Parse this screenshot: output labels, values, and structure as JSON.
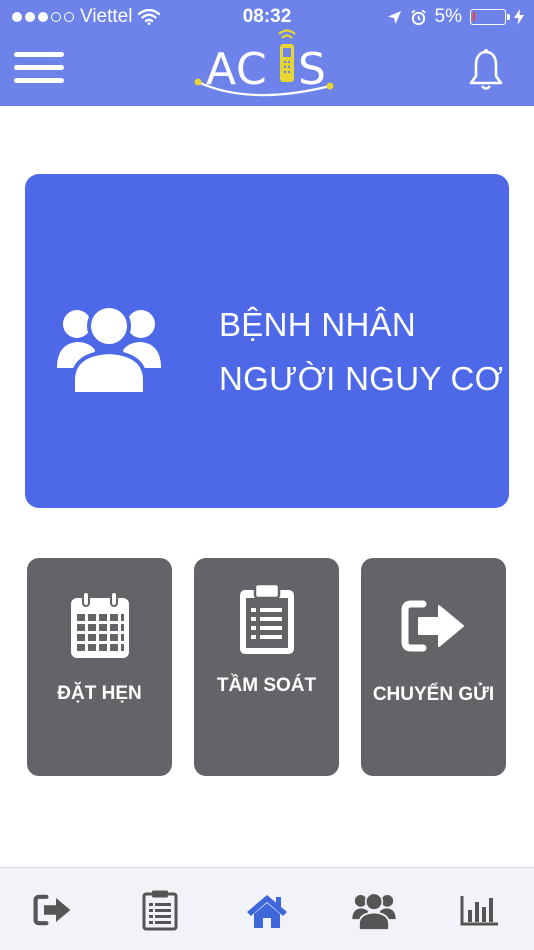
{
  "status_bar": {
    "carrier": "Viettel",
    "time": "08:32",
    "battery": "5%",
    "battery_level": 0.05
  },
  "header": {
    "logo_text": "ACIS",
    "menu_icon": "hamburger-menu-icon",
    "notification_icon": "bell-icon"
  },
  "hero": {
    "line1": "BỆNH NHÂN",
    "line2": "NGƯỜI NGUY CƠ",
    "icon": "people-group-icon"
  },
  "tiles": [
    {
      "label": "ĐẶT HẸN",
      "icon": "calendar-icon"
    },
    {
      "label": "TẦM SOÁT",
      "icon": "clipboard-icon"
    },
    {
      "label": "CHUYỂN GỬI",
      "icon": "sign-out-icon"
    }
  ],
  "tabbar": {
    "items": [
      {
        "icon": "sign-out-icon",
        "active": false
      },
      {
        "icon": "clipboard-list-icon",
        "active": false
      },
      {
        "icon": "home-icon",
        "active": true
      },
      {
        "icon": "users-icon",
        "active": false
      },
      {
        "icon": "bar-chart-icon",
        "active": false
      }
    ]
  },
  "colors": {
    "header": "#6d83e9",
    "hero": "#4d69e7",
    "tile": "#646468",
    "tab_active": "#3f67d9",
    "tab_inactive": "#555555",
    "logo_accent": "#e6d532"
  }
}
